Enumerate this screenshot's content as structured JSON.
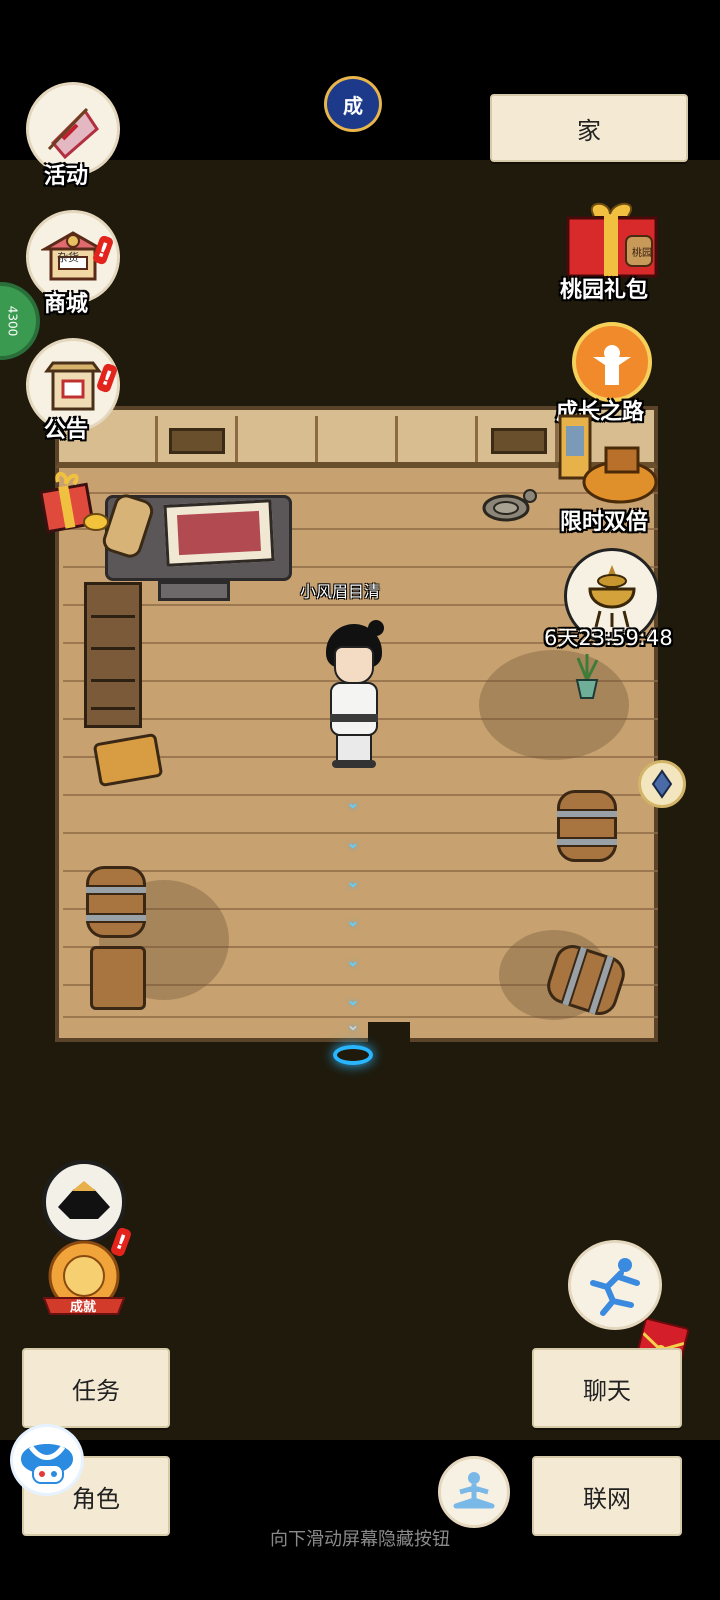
{
  "top": {
    "location_label": "家",
    "season_badge": "成"
  },
  "left_menu": {
    "activity": "活动",
    "shop": "商城",
    "shop_sign": "杂货",
    "notice": "公告",
    "side_tab_number": "4300"
  },
  "right_menu": {
    "peach_gift": "桃园礼包",
    "gift_tag": "桃园",
    "growth_road": "成长之路",
    "limited_double": "限时双倍",
    "countdown": "6天23:59:48"
  },
  "scene": {
    "player_name": "小风眉目清"
  },
  "bottom": {
    "achievement_label": "成就",
    "task": "任务",
    "role": "角色",
    "chat": "聊天",
    "network": "联网",
    "hint": "向下滑动屏幕隐藏按钮"
  },
  "icons": {
    "activity": "flag-icon",
    "shop": "shop-stall-icon",
    "notice": "notice-board-icon",
    "gift_box": "gift-box-icon",
    "peach_gift": "red-gift-box-icon",
    "growth_road": "growth-figure-icon",
    "limited_double": "treasure-pile-icon",
    "event": "golden-censer-icon",
    "diamond": "diamond-icon",
    "hat": "black-hat-icon",
    "achievement": "achievement-medal-icon",
    "sprint": "running-figure-icon",
    "red_packet": "red-packet-icon",
    "meditate": "meditation-icon",
    "gamepad_overlay": "gamepad-assistant-icon"
  },
  "colors": {
    "accent_red": "#e2241c",
    "portal_blue": "#29b5ff",
    "paper": "#f4ead4"
  }
}
